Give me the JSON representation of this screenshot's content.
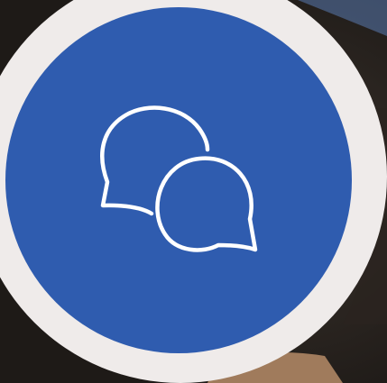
{
  "colors": {
    "accent": "#2f5caf",
    "ring": "#efebea",
    "icon_stroke": "#ffffff",
    "photo_dark": "#1e1a17",
    "photo_mid": "#3a322c",
    "photo_skin": "#a07b5c"
  },
  "icon": {
    "name": "chat-bubbles-icon"
  }
}
